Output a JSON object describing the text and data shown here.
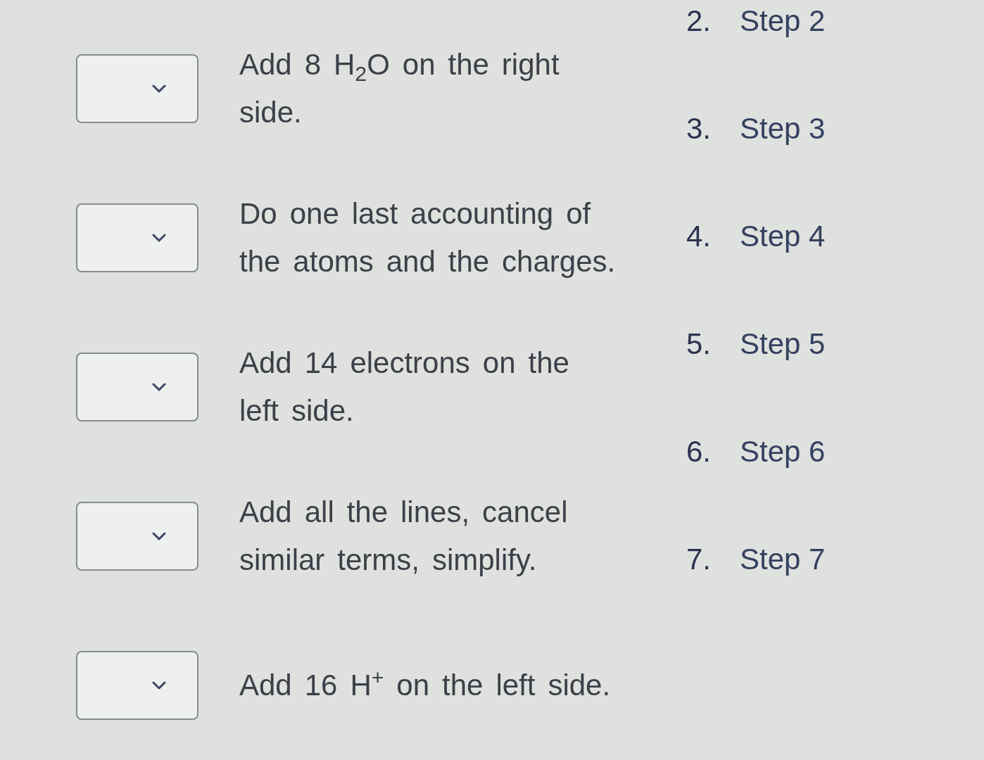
{
  "matching": {
    "rows": [
      {
        "text": "Add 8 H$_{2}$O on the right side."
      },
      {
        "text": "Do one last accounting of the atoms and the charges."
      },
      {
        "text": "Add 14 electrons on the left side."
      },
      {
        "text": "Add all the lines, cancel similar terms, simplify."
      },
      {
        "text": "Add 16 H$^{+}$ on the left side."
      }
    ]
  },
  "steps": [
    {
      "number": "2.",
      "label": "Step 2"
    },
    {
      "number": "3.",
      "label": "Step 3"
    },
    {
      "number": "4.",
      "label": "Step 4"
    },
    {
      "number": "5.",
      "label": "Step 5"
    },
    {
      "number": "6.",
      "label": "Step 6"
    },
    {
      "number": "7.",
      "label": "Step 7"
    }
  ]
}
